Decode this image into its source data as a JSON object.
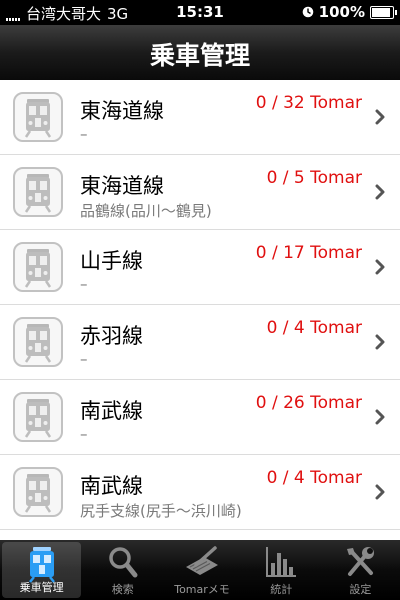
{
  "status_bar": {
    "carrier": "台湾大哥大",
    "network": "3G",
    "time": "15:31",
    "battery_percent": "100%",
    "battery_level": 1.0
  },
  "nav": {
    "title": "乗車管理"
  },
  "rows": [
    {
      "name": "東海道線",
      "sub": "–",
      "count": "0 / 32 Tomar"
    },
    {
      "name": "東海道線",
      "sub": "品鶴線(品川～鶴見)",
      "count": "0 / 5 Tomar"
    },
    {
      "name": "山手線",
      "sub": "–",
      "count": "0 / 17 Tomar"
    },
    {
      "name": "赤羽線",
      "sub": "–",
      "count": "0 / 4 Tomar"
    },
    {
      "name": "南武線",
      "sub": "–",
      "count": "0 / 26 Tomar"
    },
    {
      "name": "南武線",
      "sub": "尻手支線(尻手～浜川崎)",
      "count": "0 / 4 Tomar"
    }
  ],
  "tabs": [
    {
      "label": "乗車管理",
      "icon": "train-icon",
      "selected": true
    },
    {
      "label": "検索",
      "icon": "search-icon",
      "selected": false
    },
    {
      "label": "Tomarメモ",
      "icon": "memo-pen-icon",
      "selected": false
    },
    {
      "label": "統計",
      "icon": "bar-chart-icon",
      "selected": false
    },
    {
      "label": "設定",
      "icon": "tools-icon",
      "selected": false
    }
  ],
  "colors": {
    "count_red": "#e01010",
    "selected_train_blue": "#2a9df4"
  }
}
